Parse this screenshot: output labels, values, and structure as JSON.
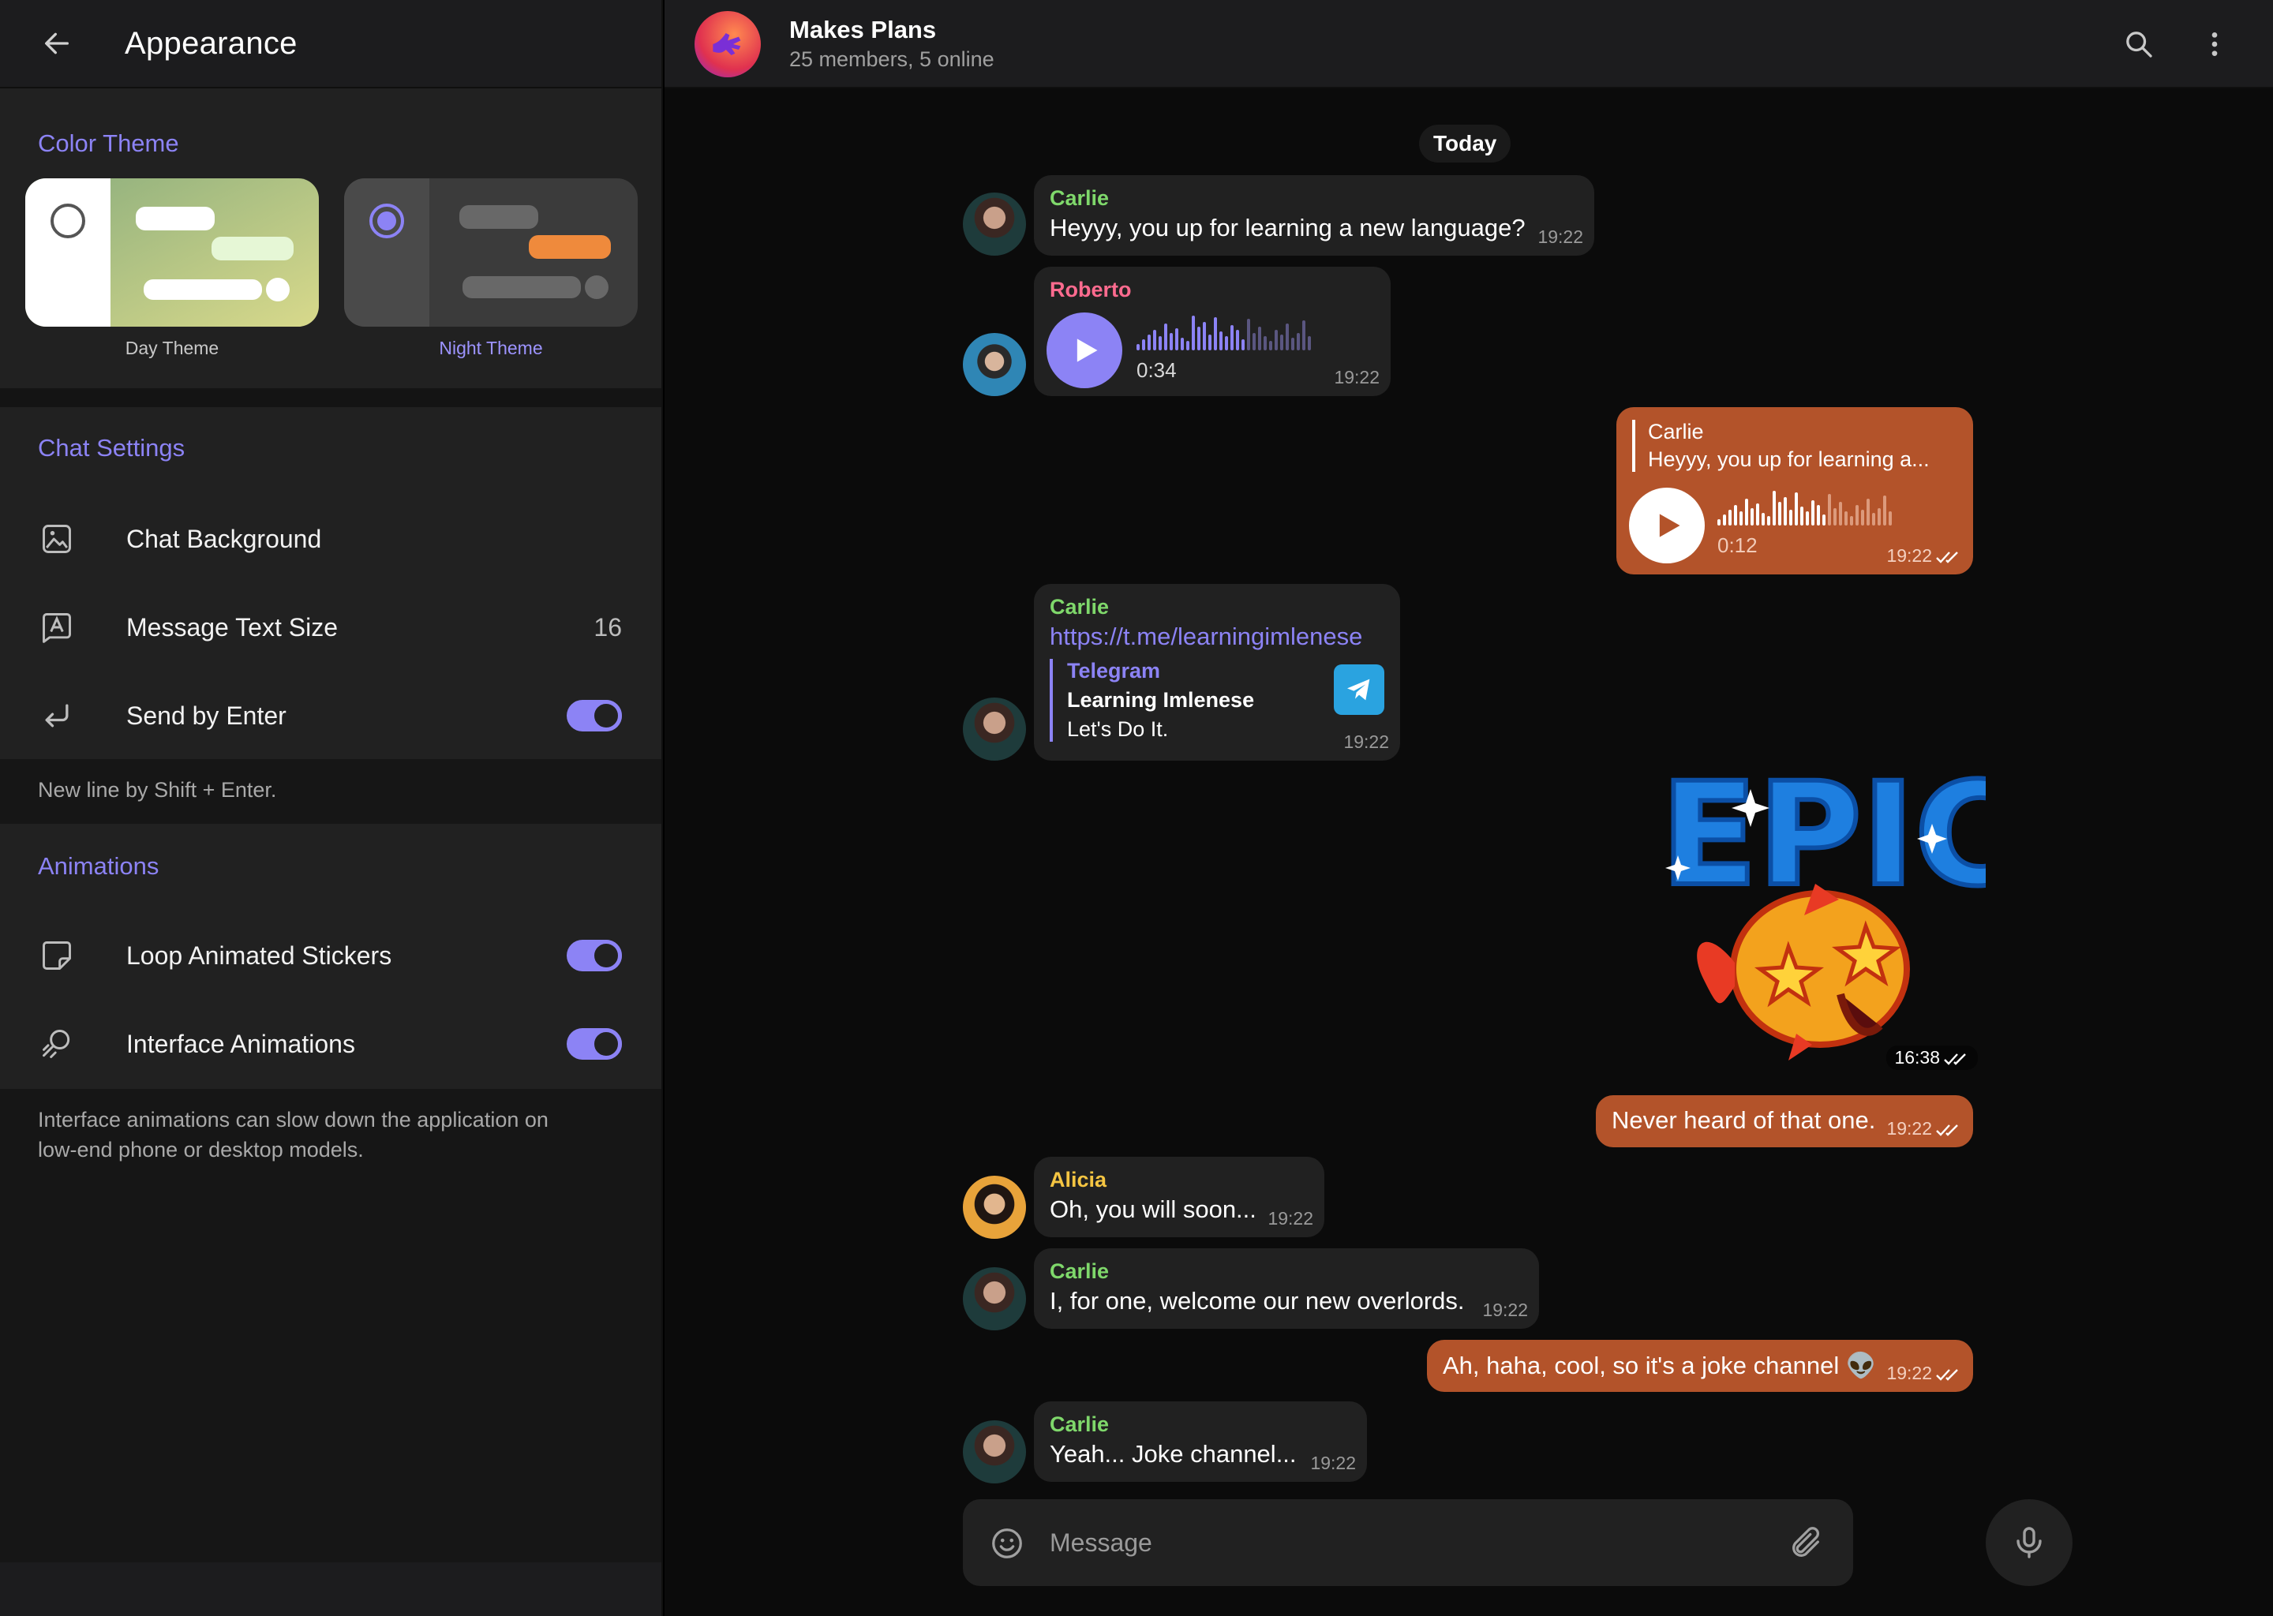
{
  "settings": {
    "title": "Appearance",
    "color_theme": {
      "section_title": "Color Theme",
      "day_label": "Day Theme",
      "night_label": "Night Theme",
      "selected": "night"
    },
    "chat_settings": {
      "section_title": "Chat Settings",
      "chat_background": "Chat Background",
      "message_text_size": "Message Text Size",
      "message_text_size_value": "16",
      "send_by_enter": "Send by Enter",
      "send_by_enter_on": true,
      "hint": "New line by Shift + Enter."
    },
    "animations": {
      "section_title": "Animations",
      "loop_stickers": "Loop Animated Stickers",
      "loop_stickers_on": true,
      "interface_animations": "Interface Animations",
      "interface_animations_on": true,
      "hint_line1": "Interface animations can slow down the application on",
      "hint_line2": "low-end phone or desktop models."
    }
  },
  "chat": {
    "title": "Makes Plans",
    "subtitle": "25 members, 5 online",
    "date": "Today",
    "messages": [
      {
        "sender": "Carlie",
        "text": "Heyyy, you up for learning a new language?",
        "time": "19:22"
      },
      {
        "sender": "Roberto",
        "duration": "0:34",
        "time": "19:22"
      },
      {
        "reply_sender": "Carlie",
        "reply_text": "Heyyy, you up for learning a...",
        "duration": "0:12",
        "time": "19:22"
      },
      {
        "sender": "Carlie",
        "link": "https://t.me/learningimlenese",
        "preview_site": "Telegram",
        "preview_title": "Learning Imlenese",
        "preview_desc": "Let's Do It.",
        "time": "19:22"
      },
      {
        "sticker": "EPIC",
        "time": "16:38"
      },
      {
        "text": "Never heard of that one.",
        "time": "19:22"
      },
      {
        "sender": "Alicia",
        "text": "Oh, you will soon...",
        "time": "19:22"
      },
      {
        "sender": "Carlie",
        "text": "I, for one, welcome our new overlords.",
        "time": "19:22"
      },
      {
        "text": "Ah, haha, cool, so it's a joke channel 👽",
        "time": "19:22"
      },
      {
        "sender": "Carlie",
        "text": "Yeah... Joke channel...",
        "time": "19:22"
      }
    ],
    "input_placeholder": "Message"
  },
  "colors": {
    "accent": "#8c83f5",
    "outgoing": "#b3532a",
    "incoming": "#212121"
  }
}
